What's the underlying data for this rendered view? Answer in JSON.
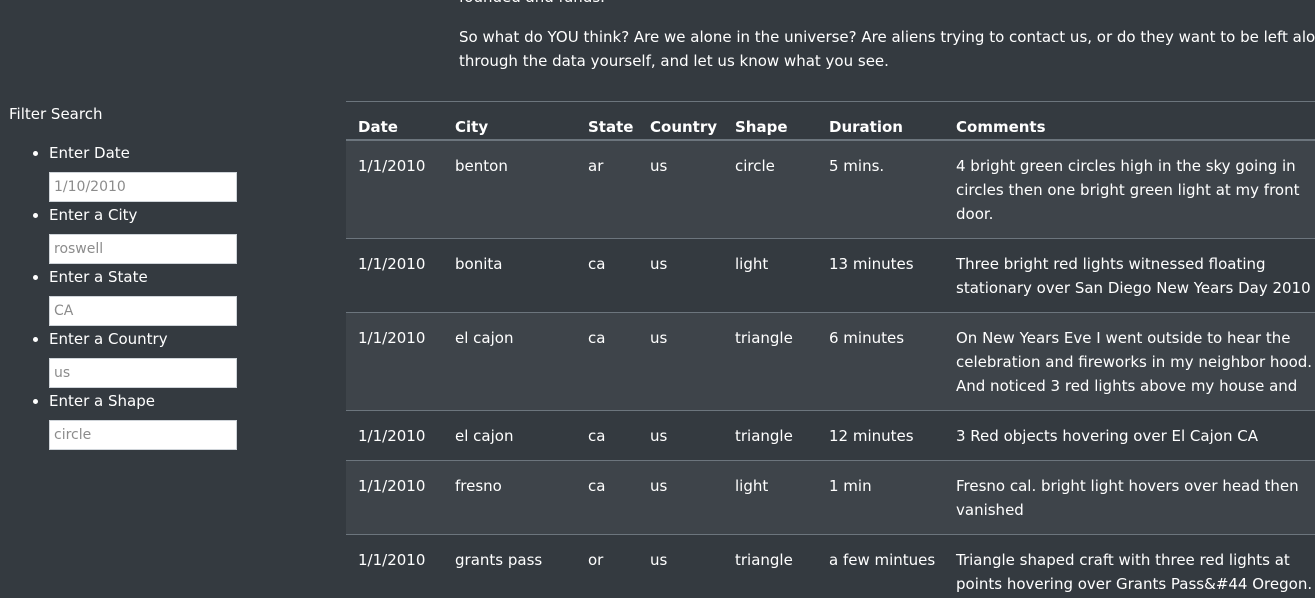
{
  "intro": {
    "line_top": "founded and funds.",
    "para_line1": "So what do YOU think? Are we alone in the universe? Are aliens trying to contact us, or do they want to be left alone? Dig",
    "para_line2": "through the data yourself, and let us know what you see."
  },
  "sidebar": {
    "title": "Filter Search",
    "filters": [
      {
        "label": "Enter Date",
        "placeholder": "1/10/2010"
      },
      {
        "label": "Enter a City",
        "placeholder": "roswell"
      },
      {
        "label": "Enter a State",
        "placeholder": "CA"
      },
      {
        "label": "Enter a Country",
        "placeholder": "us"
      },
      {
        "label": "Enter a Shape",
        "placeholder": "circle"
      }
    ]
  },
  "table": {
    "headers": [
      "Date",
      "City",
      "State",
      "Country",
      "Shape",
      "Duration",
      "Comments"
    ],
    "rows": [
      {
        "date": "1/1/2010",
        "city": "benton",
        "state": "ar",
        "country": "us",
        "shape": "circle",
        "duration": "5 mins.",
        "comments": "4 bright green circles high in the sky going in circles then one bright green light at my front door."
      },
      {
        "date": "1/1/2010",
        "city": "bonita",
        "state": "ca",
        "country": "us",
        "shape": "light",
        "duration": "13 minutes",
        "comments": "Three bright red lights witnessed floating stationary over San Diego New Years Day 2010"
      },
      {
        "date": "1/1/2010",
        "city": "el cajon",
        "state": "ca",
        "country": "us",
        "shape": "triangle",
        "duration": "6 minutes",
        "comments": "On New Years Eve I went outside to hear the celebration and fireworks in my neighbor hood. And noticed 3 red lights above my house and"
      },
      {
        "date": "1/1/2010",
        "city": "el cajon",
        "state": "ca",
        "country": "us",
        "shape": "triangle",
        "duration": "12 minutes",
        "comments": "3 Red objects hovering over El Cajon CA"
      },
      {
        "date": "1/1/2010",
        "city": "fresno",
        "state": "ca",
        "country": "us",
        "shape": "light",
        "duration": "1 min",
        "comments": "Fresno cal. bright light hovers over head then vanished"
      },
      {
        "date": "1/1/2010",
        "city": "grants pass",
        "state": "or",
        "country": "us",
        "shape": "triangle",
        "duration": "a few mintues",
        "comments": "Triangle shaped craft with three red lights at points hovering over Grants Pass&#44 Oregon."
      }
    ]
  },
  "colors": {
    "background": "#343a40",
    "stripe": "#3e444a",
    "border": "#6c757d",
    "text": "#ffffff"
  }
}
